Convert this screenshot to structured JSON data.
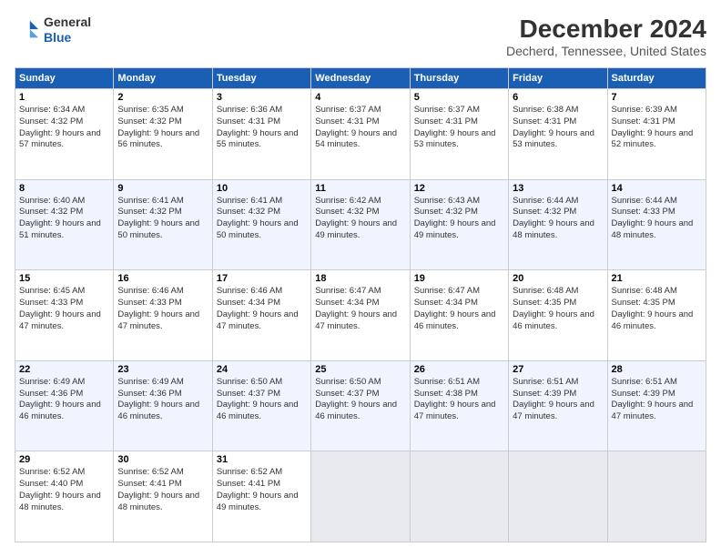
{
  "header": {
    "logo_line1": "General",
    "logo_line2": "Blue",
    "title": "December 2024",
    "subtitle": "Decherd, Tennessee, United States"
  },
  "days_of_week": [
    "Sunday",
    "Monday",
    "Tuesday",
    "Wednesday",
    "Thursday",
    "Friday",
    "Saturday"
  ],
  "weeks": [
    [
      {
        "day": "1",
        "sunrise": "6:34 AM",
        "sunset": "4:32 PM",
        "daylight": "9 hours and 57 minutes."
      },
      {
        "day": "2",
        "sunrise": "6:35 AM",
        "sunset": "4:32 PM",
        "daylight": "9 hours and 56 minutes."
      },
      {
        "day": "3",
        "sunrise": "6:36 AM",
        "sunset": "4:31 PM",
        "daylight": "9 hours and 55 minutes."
      },
      {
        "day": "4",
        "sunrise": "6:37 AM",
        "sunset": "4:31 PM",
        "daylight": "9 hours and 54 minutes."
      },
      {
        "day": "5",
        "sunrise": "6:37 AM",
        "sunset": "4:31 PM",
        "daylight": "9 hours and 53 minutes."
      },
      {
        "day": "6",
        "sunrise": "6:38 AM",
        "sunset": "4:31 PM",
        "daylight": "9 hours and 53 minutes."
      },
      {
        "day": "7",
        "sunrise": "6:39 AM",
        "sunset": "4:31 PM",
        "daylight": "9 hours and 52 minutes."
      }
    ],
    [
      {
        "day": "8",
        "sunrise": "6:40 AM",
        "sunset": "4:32 PM",
        "daylight": "9 hours and 51 minutes."
      },
      {
        "day": "9",
        "sunrise": "6:41 AM",
        "sunset": "4:32 PM",
        "daylight": "9 hours and 50 minutes."
      },
      {
        "day": "10",
        "sunrise": "6:41 AM",
        "sunset": "4:32 PM",
        "daylight": "9 hours and 50 minutes."
      },
      {
        "day": "11",
        "sunrise": "6:42 AM",
        "sunset": "4:32 PM",
        "daylight": "9 hours and 49 minutes."
      },
      {
        "day": "12",
        "sunrise": "6:43 AM",
        "sunset": "4:32 PM",
        "daylight": "9 hours and 49 minutes."
      },
      {
        "day": "13",
        "sunrise": "6:44 AM",
        "sunset": "4:32 PM",
        "daylight": "9 hours and 48 minutes."
      },
      {
        "day": "14",
        "sunrise": "6:44 AM",
        "sunset": "4:33 PM",
        "daylight": "9 hours and 48 minutes."
      }
    ],
    [
      {
        "day": "15",
        "sunrise": "6:45 AM",
        "sunset": "4:33 PM",
        "daylight": "9 hours and 47 minutes."
      },
      {
        "day": "16",
        "sunrise": "6:46 AM",
        "sunset": "4:33 PM",
        "daylight": "9 hours and 47 minutes."
      },
      {
        "day": "17",
        "sunrise": "6:46 AM",
        "sunset": "4:34 PM",
        "daylight": "9 hours and 47 minutes."
      },
      {
        "day": "18",
        "sunrise": "6:47 AM",
        "sunset": "4:34 PM",
        "daylight": "9 hours and 47 minutes."
      },
      {
        "day": "19",
        "sunrise": "6:47 AM",
        "sunset": "4:34 PM",
        "daylight": "9 hours and 46 minutes."
      },
      {
        "day": "20",
        "sunrise": "6:48 AM",
        "sunset": "4:35 PM",
        "daylight": "9 hours and 46 minutes."
      },
      {
        "day": "21",
        "sunrise": "6:48 AM",
        "sunset": "4:35 PM",
        "daylight": "9 hours and 46 minutes."
      }
    ],
    [
      {
        "day": "22",
        "sunrise": "6:49 AM",
        "sunset": "4:36 PM",
        "daylight": "9 hours and 46 minutes."
      },
      {
        "day": "23",
        "sunrise": "6:49 AM",
        "sunset": "4:36 PM",
        "daylight": "9 hours and 46 minutes."
      },
      {
        "day": "24",
        "sunrise": "6:50 AM",
        "sunset": "4:37 PM",
        "daylight": "9 hours and 46 minutes."
      },
      {
        "day": "25",
        "sunrise": "6:50 AM",
        "sunset": "4:37 PM",
        "daylight": "9 hours and 46 minutes."
      },
      {
        "day": "26",
        "sunrise": "6:51 AM",
        "sunset": "4:38 PM",
        "daylight": "9 hours and 47 minutes."
      },
      {
        "day": "27",
        "sunrise": "6:51 AM",
        "sunset": "4:39 PM",
        "daylight": "9 hours and 47 minutes."
      },
      {
        "day": "28",
        "sunrise": "6:51 AM",
        "sunset": "4:39 PM",
        "daylight": "9 hours and 47 minutes."
      }
    ],
    [
      {
        "day": "29",
        "sunrise": "6:52 AM",
        "sunset": "4:40 PM",
        "daylight": "9 hours and 48 minutes."
      },
      {
        "day": "30",
        "sunrise": "6:52 AM",
        "sunset": "4:41 PM",
        "daylight": "9 hours and 48 minutes."
      },
      {
        "day": "31",
        "sunrise": "6:52 AM",
        "sunset": "4:41 PM",
        "daylight": "9 hours and 49 minutes."
      },
      null,
      null,
      null,
      null
    ]
  ]
}
